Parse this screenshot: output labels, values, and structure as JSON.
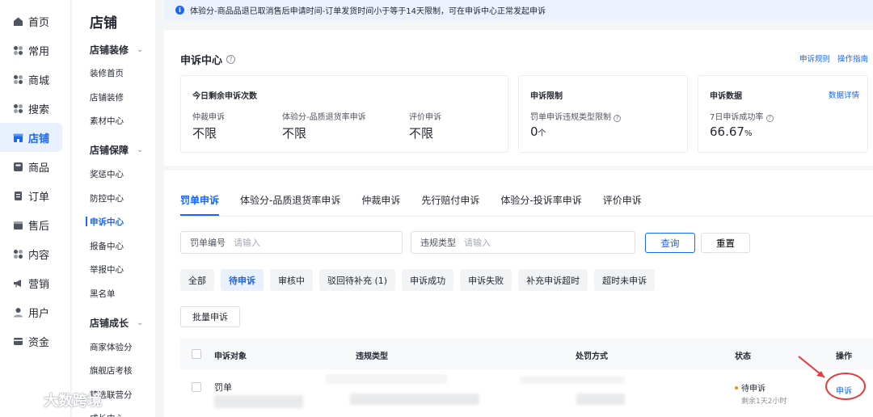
{
  "nav": [
    {
      "label": "首页",
      "icon": "home-icon"
    },
    {
      "label": "常用",
      "icon": "grid-icon"
    },
    {
      "label": "商城",
      "icon": "grid-icon"
    },
    {
      "label": "搜索",
      "icon": "grid-icon"
    },
    {
      "label": "店铺",
      "icon": "shop-icon",
      "active": true
    },
    {
      "label": "商品",
      "icon": "product-icon"
    },
    {
      "label": "订单",
      "icon": "order-icon"
    },
    {
      "label": "售后",
      "icon": "aftersale-icon"
    },
    {
      "label": "内容",
      "icon": "grid-icon"
    },
    {
      "label": "营销",
      "icon": "marketing-icon"
    },
    {
      "label": "用户",
      "icon": "user-icon"
    },
    {
      "label": "资金",
      "icon": "wallet-icon"
    }
  ],
  "submenu": {
    "title": "店铺",
    "groups": [
      {
        "label": "店铺装修",
        "items": [
          "装修首页",
          "店铺装修",
          "素材中心"
        ]
      },
      {
        "label": "店铺保障",
        "items": [
          "奖惩中心",
          "防控中心",
          "申诉中心",
          "报备中心",
          "举报中心",
          "黑名单"
        ]
      },
      {
        "label": "店铺成长",
        "items": [
          "商家体验分",
          "旗舰店考核",
          "精选联营分",
          "成长中心"
        ]
      }
    ],
    "active_item": "申诉中心"
  },
  "notice": "体验分-商品品退已取消售后申请时间-订单发货时间小于等于14天限制，可在申诉中心正常发起申诉",
  "appeal_center": {
    "title": "申诉中心",
    "links": [
      "申诉规则",
      "操作指南"
    ],
    "remaining": {
      "title": "今日剩余申诉次数",
      "items": [
        {
          "label": "仲裁申诉",
          "value": "不限"
        },
        {
          "label": "体验分-品质退货率申诉",
          "value": "不限"
        },
        {
          "label": "评价申诉",
          "value": "不限"
        }
      ]
    },
    "limit": {
      "title": "申诉限制",
      "label": "罚单申诉违规类型限制",
      "value": "0",
      "unit": "个"
    },
    "stats": {
      "title": "申诉数据",
      "link": "数据详情",
      "label": "7日申诉成功率",
      "value": "66.67",
      "unit": "%"
    }
  },
  "tabs": [
    "罚单申诉",
    "体验分-品质退货率申诉",
    "仲裁申诉",
    "先行赔付申诉",
    "体验分-投诉率申诉",
    "评价申诉"
  ],
  "filters": {
    "ticket_label": "罚单编号",
    "ticket_placeholder": "请输入",
    "violation_label": "违规类型",
    "violation_placeholder": "请输入",
    "search": "查询",
    "reset": "重置"
  },
  "status_chips": [
    "全部",
    "待申诉",
    "审核中",
    "驳回待补充 (1)",
    "申诉成功",
    "申诉失败",
    "补充申诉超时",
    "超时未申诉"
  ],
  "active_chip": "待申诉",
  "batch_button": "批量申诉",
  "table": {
    "columns": [
      "申诉对象",
      "违规类型",
      "处罚方式",
      "状态",
      "操作"
    ],
    "rows": [
      {
        "object": "罚单",
        "status": "待申诉",
        "status_sub": "剩余1天2小时",
        "action": "申诉"
      }
    ]
  },
  "watermark": "大数跨境",
  "colors": {
    "accent": "#1966ff",
    "annotation": "#e53b3b",
    "pending": "#ff8a00"
  }
}
